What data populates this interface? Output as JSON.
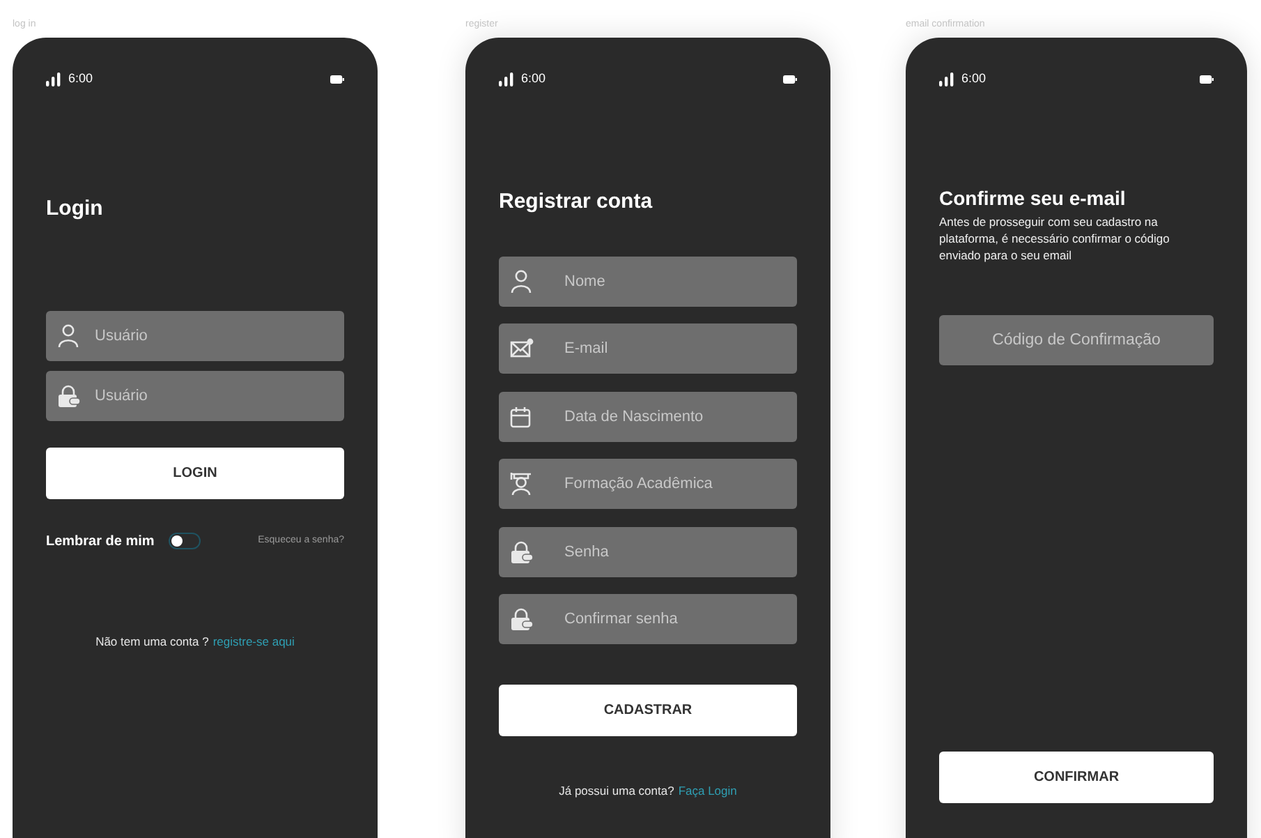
{
  "screens": [
    {
      "kind": "login",
      "caption": "log in",
      "status_bar": {
        "time": "6:00"
      },
      "title": "Login",
      "fields": [
        {
          "kind": "user",
          "placeholder": "Usuário"
        },
        {
          "kind": "password",
          "placeholder": "Usuário"
        }
      ],
      "button": "LOGIN",
      "remember": {
        "label": "Lembrar de mim",
        "on": false
      },
      "forgot_link": "Esqueceu a senha?",
      "footer": {
        "text": "Não tem uma conta ?",
        "link": "registre-se aqui"
      }
    },
    {
      "kind": "register",
      "caption": "register",
      "status_bar": {
        "time": "6:00"
      },
      "title": "Registrar conta",
      "fields": [
        {
          "kind": "user",
          "placeholder": "Nome"
        },
        {
          "kind": "email",
          "placeholder": "E-mail"
        },
        {
          "kind": "date",
          "placeholder": "Data de Nascimento"
        },
        {
          "kind": "education",
          "placeholder": "Formação Acadêmica"
        },
        {
          "kind": "password",
          "placeholder": "Senha"
        },
        {
          "kind": "password",
          "placeholder": "Confirmar senha"
        }
      ],
      "button": "CADASTRAR",
      "footer": {
        "text": "Já possui uma conta?",
        "link": "Faça Login"
      }
    },
    {
      "kind": "confirm",
      "caption": "email confirmation",
      "status_bar": {
        "time": "6:00"
      },
      "title": "Confirme seu e-mail",
      "description": "Antes de prosseguir com seu cadastro na plataforma, é necessário confirmar o código enviado para o seu email",
      "fields": [
        {
          "kind": "code",
          "placeholder": "Código de Confirmação"
        }
      ],
      "button": "CONFIRMAR"
    }
  ]
}
